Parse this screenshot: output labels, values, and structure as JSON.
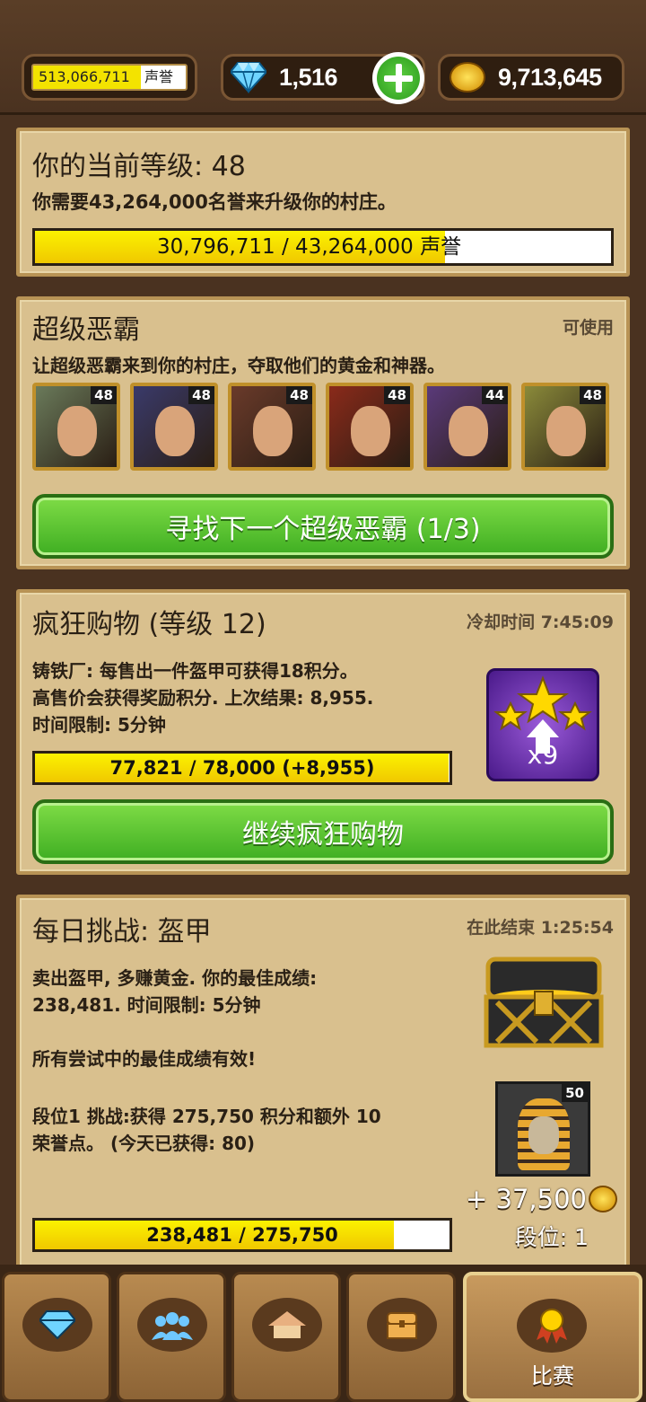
{
  "topbar": {
    "reputation_value": "513,066,711",
    "reputation_unit": "声誉",
    "gems": "1,516",
    "gold": "9,713,645"
  },
  "level_card": {
    "title": "你的当前等级: 48",
    "description": "你需要43,264,000名誉来升级你的村庄。",
    "progress_text": "30,796,711 / 43,264,000",
    "progress_unit": "声誉",
    "progress_fraction": 0.712
  },
  "villain_card": {
    "title": "超级恶霸",
    "status": "可使用",
    "description": "让超级恶霸来到你的村庄，夺取他们的黄金和神器。",
    "portraits": [
      {
        "level": "48",
        "color": "#6a7a5a"
      },
      {
        "level": "48",
        "color": "#3a3a6a"
      },
      {
        "level": "48",
        "color": "#6a3a2a"
      },
      {
        "level": "48",
        "color": "#8a2a1a"
      },
      {
        "level": "44",
        "color": "#5a3a7a"
      },
      {
        "level": "48",
        "color": "#8a8a3a"
      }
    ],
    "button_label": "寻找下一个超级恶霸 (1/3)"
  },
  "shopping_card": {
    "title": "疯狂购物 (等级 12)",
    "cooldown": "冷却时间 7:45:09",
    "line1": "铸铁厂: 每售出一件盔甲可获得18积分。",
    "line2": "高售价会获得奖励积分. 上次结果: 8,955.",
    "line3": "时间限制: 5分钟",
    "badge_label": "x9",
    "progress_text": "77,821 / 78,000 (+8,955)",
    "progress_fraction": 0.998,
    "button_label": "继续疯狂购物"
  },
  "challenge_card": {
    "title": "每日挑战: 盔甲",
    "ends": "在此结束 1:25:54",
    "line1": "卖出盔甲, 多赚黄金. 你的最佳成绩:",
    "line2": "238,481. 时间限制: 5分钟",
    "line3": "所有尝试中的最佳成绩有效!",
    "line4": "段位1 挑战:获得 275,750 积分和额外 10",
    "line5": "荣誉点。 (今天已获得: 80)",
    "mummy_level": "50",
    "reward": "+ 37,500",
    "rank": "段位: 1",
    "progress_text": "238,481 / 275,750",
    "progress_fraction": 0.865
  },
  "tabbar": {
    "active_label": "比赛"
  },
  "colors": {
    "accent_green": "#3fae22",
    "progress_yellow": "#f3e300",
    "card_bg": "#d9c08e"
  },
  "icons": [
    "diamond-icon",
    "group-icon",
    "village-icon",
    "chest-icon",
    "medal-icon"
  ]
}
